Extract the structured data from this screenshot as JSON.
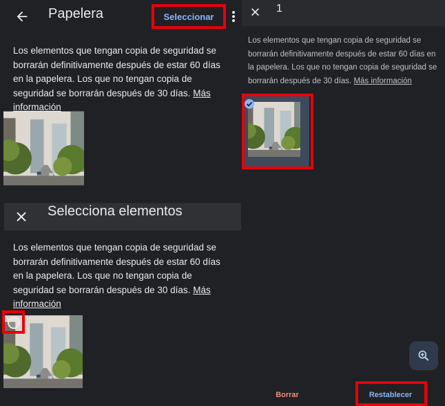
{
  "trash": {
    "title": "Papelera",
    "select_label": "Seleccionar",
    "description": "Los elementos que tengan copia de seguridad se borrarán definitivamente después de estar 60 días en la papelera. Los que no tengan copia de seguridad se borrarán después de 30 días.",
    "more_info": "Más información",
    "icons": {
      "back": "arrow-back-icon",
      "menu": "more-vert-icon"
    }
  },
  "select_mode": {
    "title": "Selecciona elementos",
    "description": "Los elementos que tengan copia de seguridad se borrarán definitivamente después de estar 60 días en la papelera. Los que no tengan copia de seguridad se borrarán después de 30 días.",
    "more_info": "Más información",
    "icons": {
      "close": "close-icon",
      "select_circle": "circle-outline-icon"
    }
  },
  "selected": {
    "count": "1",
    "description": "Los elementos que tengan copia de seguridad se borrarán definitivamente después de estar 60 días en la papelera. Los que no tengan copia de seguridad se borrarán después de 30 días.",
    "more_info": "Más información",
    "delete_label": "Borrar",
    "restore_label": "Restablecer",
    "icons": {
      "close": "close-icon",
      "check": "check-circle-icon",
      "zoom": "zoom-in-icon"
    }
  },
  "colors": {
    "highlight": "#e8000b",
    "accent": "#8ab4f8",
    "background": "#202124"
  }
}
